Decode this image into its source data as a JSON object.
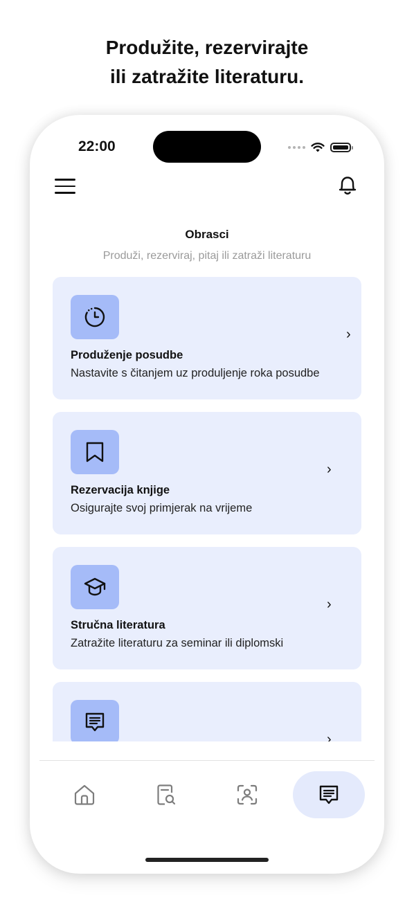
{
  "promo": {
    "line1": "Produžite, rezervirajte",
    "line2": "ili zatražite literaturu."
  },
  "status_bar": {
    "time": "22:00"
  },
  "header": {
    "title": "Obrasci",
    "subtitle": "Produži, rezerviraj, pitaj ili zatraži literaturu"
  },
  "cards": [
    {
      "icon": "timer-icon",
      "title": "Produženje posudbe",
      "description": "Nastavite s čitanjem uz produljenje roka posudbe"
    },
    {
      "icon": "bookmark-icon",
      "title": "Rezervacija knjige",
      "description": "Osigurajte svoj primjerak na vrijeme"
    },
    {
      "icon": "graduation-cap-icon",
      "title": "Stručna literatura",
      "description": "Zatražite literaturu za seminar ili diplomski"
    },
    {
      "icon": "message-icon",
      "title": "",
      "description": ""
    }
  ],
  "tabs": [
    {
      "icon": "home-icon",
      "active": false
    },
    {
      "icon": "document-search-icon",
      "active": false
    },
    {
      "icon": "scan-person-icon",
      "active": false
    },
    {
      "icon": "message-icon",
      "active": true
    }
  ],
  "colors": {
    "card_bg": "#e9eefd",
    "icon_bg": "#a5bbf8",
    "active_tab_bg": "#e4eafc",
    "subtitle": "#9a9a9a"
  }
}
